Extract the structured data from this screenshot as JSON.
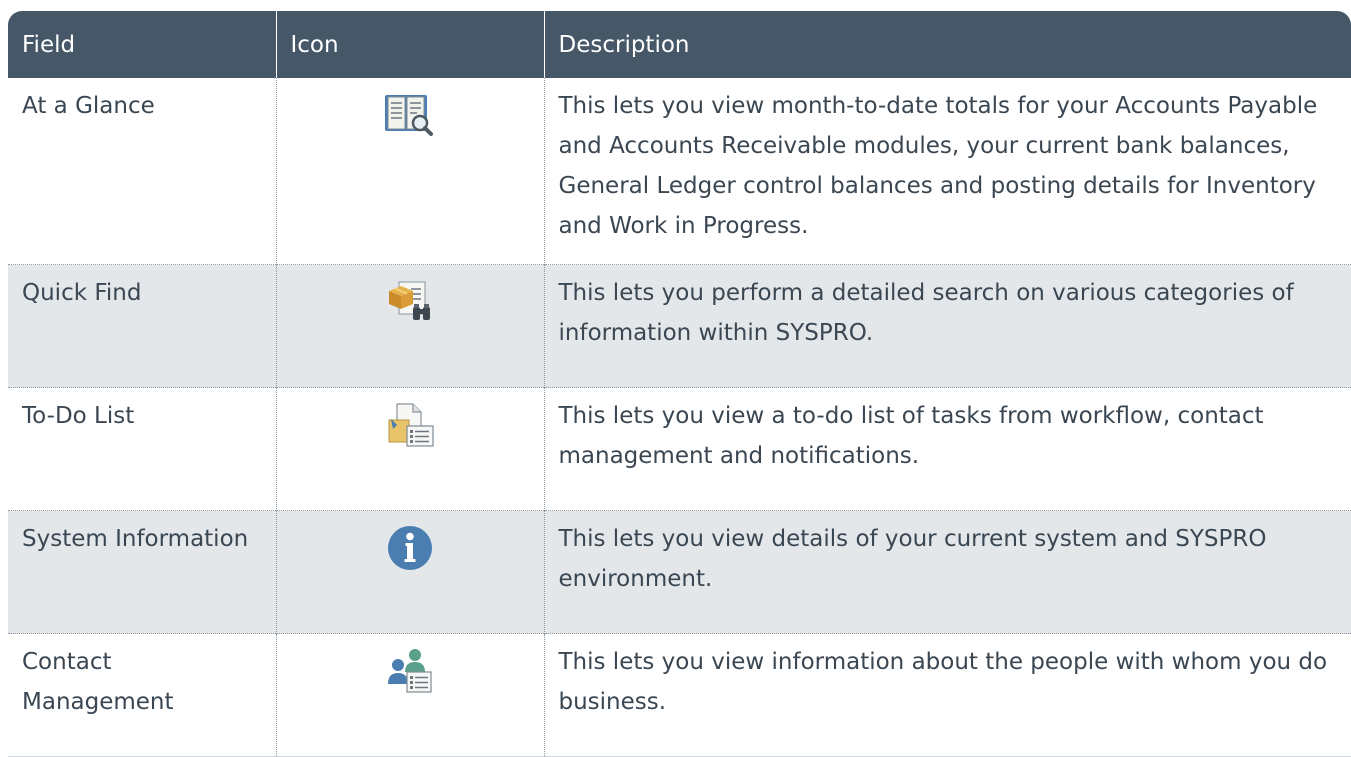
{
  "table": {
    "headers": {
      "field": "Field",
      "icon": "Icon",
      "description": "Description"
    },
    "rows": [
      {
        "field": "At a Glance",
        "icon": "book-magnifier-icon",
        "description": "This lets you view month-to-date totals for your Accounts Payable and Accounts Receivable modules, your current bank balances, General Ledger control balances and posting details for Inventory and Work in Progress."
      },
      {
        "field": "Quick Find",
        "icon": "package-binoculars-icon",
        "description": "This lets you perform a detailed search on various categories of information within SYSPRO."
      },
      {
        "field": "To-Do List",
        "icon": "document-list-icon",
        "description": "This lets you view a to-do list of tasks from workflow, contact management and notifications."
      },
      {
        "field": "System Information",
        "icon": "info-icon",
        "description": "This lets you view details of your current system and SYSPRO environment."
      },
      {
        "field": "Contact Management",
        "icon": "contacts-card-icon",
        "description": "This lets you view information about the people with whom you do business."
      }
    ]
  },
  "colors": {
    "header_bg": "#465868",
    "header_text": "#ffffff",
    "alt_row_bg": "#e4e7ea",
    "body_text": "#3a4752",
    "icon_blue": "#4a7db0"
  }
}
